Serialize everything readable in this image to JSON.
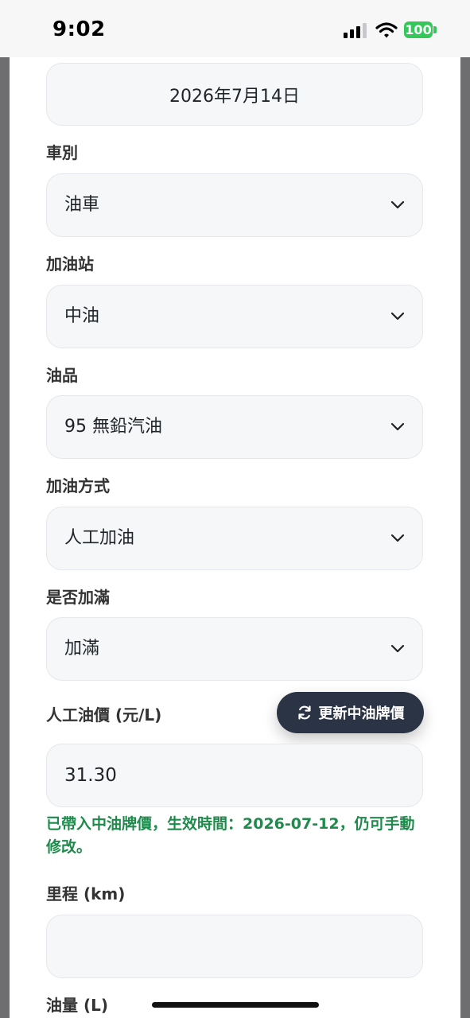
{
  "status_bar": {
    "time": "9:02",
    "battery": "100"
  },
  "form": {
    "date": "2026年7月14日",
    "vehicle_type": {
      "label": "車別",
      "value": "油車"
    },
    "gas_station": {
      "label": "加油站",
      "value": "中油"
    },
    "fuel_product": {
      "label": "油品",
      "value": "95 無鉛汽油"
    },
    "fueling_method": {
      "label": "加油方式",
      "value": "人工加油"
    },
    "full_tank": {
      "label": "是否加滿",
      "value": "加滿"
    },
    "manual_price": {
      "label": "人工油價 (元/L)",
      "value": "31.30"
    },
    "update_button_label": "更新中油牌價",
    "price_hint": "已帶入中油牌價，生效時間：2026-07-12，仍可手動修改。",
    "mileage": {
      "label": "里程 (km)",
      "value": ""
    },
    "fuel_amount": {
      "label": "油量 (L)"
    }
  },
  "colors": {
    "hint_green": "#1f8a4c",
    "button_dark": "#2b3444",
    "battery_green": "#34c759"
  },
  "icons": [
    "signal-icon",
    "wifi-icon",
    "chevron-down-icon",
    "refresh-icon"
  ]
}
